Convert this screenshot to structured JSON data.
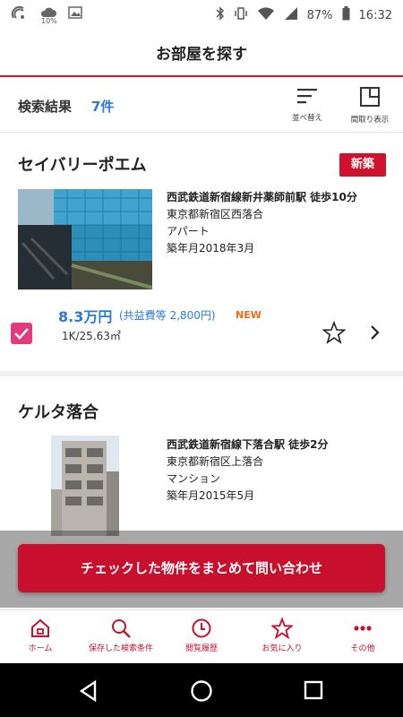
{
  "status_bar": {
    "left_icons": [
      "nfc-icon",
      "cloud-icon",
      "image-icon"
    ],
    "data_percent": "10%",
    "battery": "87%",
    "time": "16:32"
  },
  "header": {
    "title": "お部屋を探す"
  },
  "results": {
    "label": "検索結果",
    "count": "7件",
    "sort_label": "並べ替え",
    "layout_label": "間取り表示"
  },
  "listings": [
    {
      "name": "セイバリーポエム",
      "badge": "新築",
      "station": "西武鉄道新宿線新井薬師前駅 徒歩10分",
      "address": "東京都新宿区西落合",
      "type": "アパート",
      "built": "築年月2018年3月",
      "price": "8.3万円",
      "fee": "(共益費等 2,800円)",
      "new_tag": "NEW",
      "layout": "1K/25.63㎡",
      "checked": true
    },
    {
      "name": "ケルタ落合",
      "station": "西武鉄道新宿線下落合駅 徒歩2分",
      "address": "東京都新宿区上落合",
      "type": "マンション",
      "built": "築年月2015年5月"
    }
  ],
  "cta": {
    "label": "チェックした物件をまとめて問い合わせ"
  },
  "bottom_nav": [
    {
      "label": "ホーム",
      "icon": "home-icon"
    },
    {
      "label": "保存した検索条件",
      "icon": "search-icon"
    },
    {
      "label": "閲覧履歴",
      "icon": "clock-icon"
    },
    {
      "label": "お気に入り",
      "icon": "star-icon"
    },
    {
      "label": "その他",
      "icon": "more-icon"
    }
  ],
  "colors": {
    "brand_red": "#c8102e",
    "accent_blue": "#2a7ad8",
    "new_orange": "#ef6a1a",
    "check_pink": "#e23a7c"
  }
}
